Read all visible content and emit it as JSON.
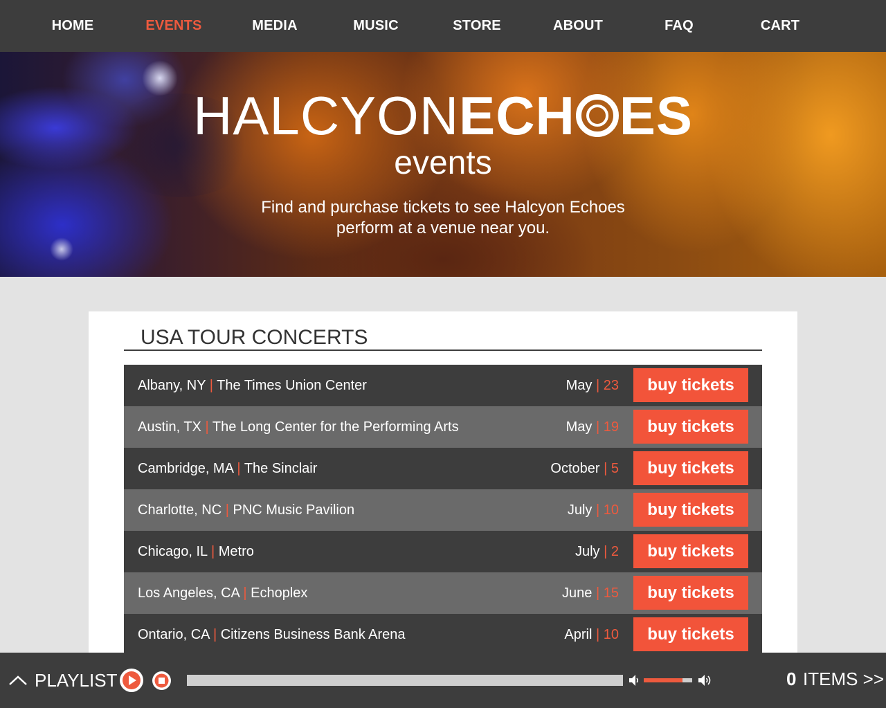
{
  "nav": {
    "items": [
      {
        "label": "HOME",
        "active": false
      },
      {
        "label": "EVENTS",
        "active": true
      },
      {
        "label": "MEDIA",
        "active": false
      },
      {
        "label": "MUSIC",
        "active": false
      },
      {
        "label": "STORE",
        "active": false
      },
      {
        "label": "ABOUT",
        "active": false
      },
      {
        "label": "FAQ",
        "active": false
      },
      {
        "label": "CART",
        "active": false
      }
    ]
  },
  "hero": {
    "title_thin": "HALCYON",
    "title_bold_a": "ECH",
    "title_bold_b": "ES",
    "subtitle": "events",
    "tagline": "Find and purchase tickets to see Halcyon Echoes perform at a venue near you."
  },
  "concerts": {
    "heading": "USA TOUR CONCERTS",
    "separator": "|",
    "buy_label": "buy tickets",
    "rows": [
      {
        "city": "Albany, NY",
        "venue": "The Times Union Center",
        "month": "May",
        "day": "23"
      },
      {
        "city": "Austin, TX",
        "venue": "The Long Center for the Performing Arts",
        "month": "May",
        "day": "19"
      },
      {
        "city": "Cambridge, MA",
        "venue": "The Sinclair",
        "month": "October",
        "day": "5"
      },
      {
        "city": "Charlotte, NC",
        "venue": "PNC Music Pavilion",
        "month": "July",
        "day": "10"
      },
      {
        "city": "Chicago, IL",
        "venue": "Metro",
        "month": "July",
        "day": "2"
      },
      {
        "city": "Los Angeles, CA",
        "venue": "Echoplex",
        "month": "June",
        "day": "15"
      },
      {
        "city": "Ontario, CA",
        "venue": "Citizens Business Bank Arena",
        "month": "April",
        "day": "10"
      }
    ]
  },
  "player": {
    "playlist_label": "PLAYLIST",
    "progress": 0,
    "volume": 0.8,
    "cart_count": "0",
    "cart_label": "ITEMS >>"
  },
  "colors": {
    "accent": "#ee5a3e",
    "button": "#f2543a",
    "dark": "#3d3d3d",
    "row_light": "#6a6a6a"
  },
  "icons": {
    "expand": "chevron-up-icon",
    "play": "play-icon",
    "stop": "stop-icon",
    "volume_low": "volume-low-icon",
    "volume_high": "volume-high-icon"
  }
}
